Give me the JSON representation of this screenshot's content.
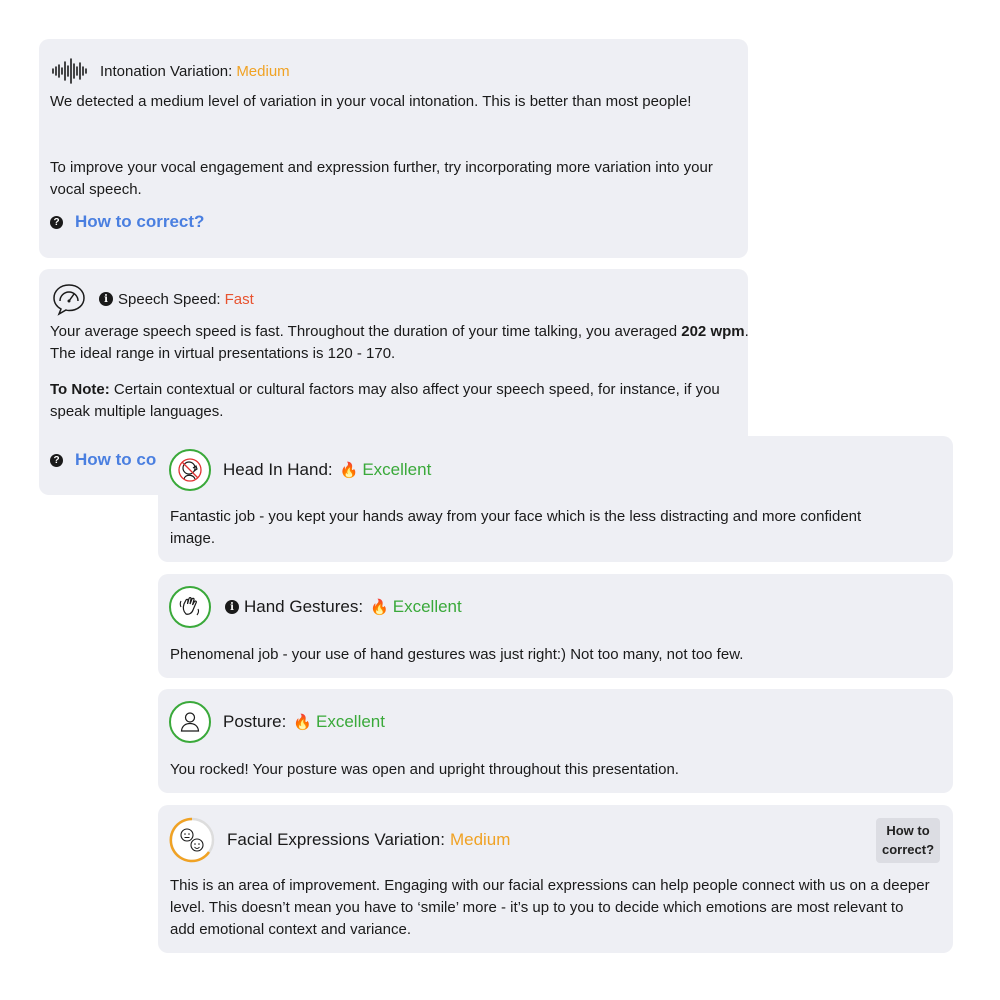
{
  "intonation": {
    "label": "Intonation Variation:",
    "value": "Medium",
    "p1": "We detected a medium level of variation in your vocal intonation. This is better than most people!",
    "p2": "To improve your vocal engagement and expression further, try incorporating more variation into your vocal speech.",
    "help": "How to correct?",
    "icon": "waveform-icon"
  },
  "speed": {
    "label": "Speech Speed:",
    "value": "Fast",
    "p1_a": "Your average speech speed is fast. Throughout the duration of your time talking, you averaged ",
    "p1_bold": "202 wpm",
    "p1_b": ". The ideal range in virtual presentations is 120 - 170.",
    "p2_bold": "To Note:",
    "p2": " Certain contextual or cultural factors may also affect your speech speed, for instance, if you speak multiple languages.",
    "help": "How to co",
    "icon": "speech-speedometer-icon"
  },
  "head_in_hand": {
    "label": "Head In Hand:",
    "value": "Excellent",
    "text": "Fantastic job - you kept your hands away from your face which is the less distracting and more confident image.",
    "icon": "no-head-in-hand-icon"
  },
  "gestures": {
    "label": "Hand Gestures:",
    "value": "Excellent",
    "text": "Phenomenal job - your use of hand gestures was just right:) Not too many, not too few.",
    "icon": "waving-hand-icon"
  },
  "posture": {
    "label": "Posture:",
    "value": "Excellent",
    "text": "You rocked! Your posture was open and upright throughout this presentation.",
    "icon": "person-icon"
  },
  "facial": {
    "label": "Facial Expressions Variation:",
    "value": "Medium",
    "text": "This is an area of improvement. Engaging with our facial expressions can help people connect with us on a deeper level. This doesn’t mean you have to ‘smile’ more - it’s up to you to decide which emotions are most relevant to add emotional context and variance.",
    "button": "How to correct?",
    "icon": "faces-icon"
  },
  "colors": {
    "medium": "#f0a224",
    "fast": "#e8532f",
    "excellent": "#3aa93a",
    "link": "#4a7fe0",
    "card_bg": "#eeeff4"
  }
}
